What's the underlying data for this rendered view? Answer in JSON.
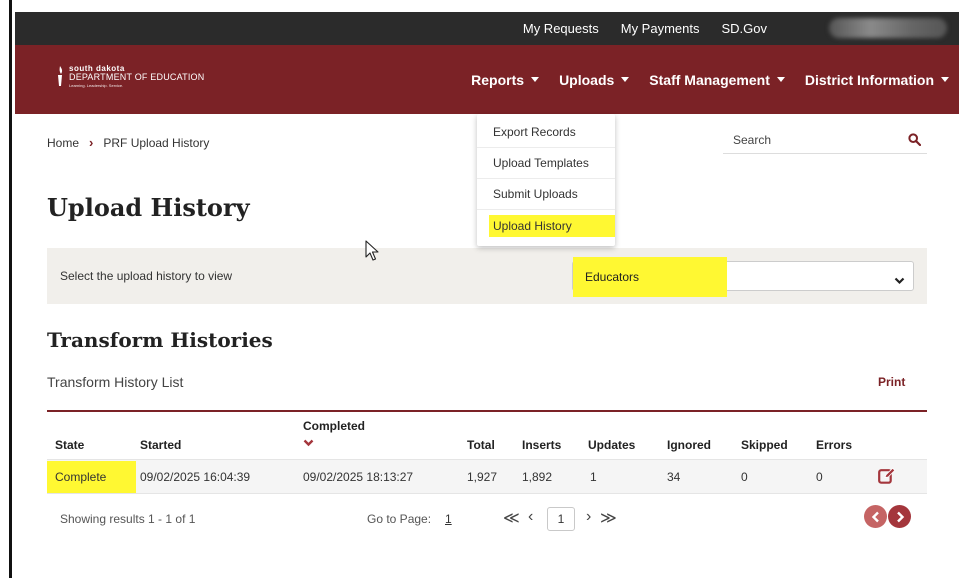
{
  "utility": {
    "links": [
      "My Requests",
      "My Payments",
      "SD.Gov"
    ]
  },
  "logo": {
    "line1": "south dakota",
    "line2": "DEPARTMENT OF EDUCATION",
    "line3": "Learning. Leadership. Service."
  },
  "nav": {
    "items": [
      "Reports",
      "Uploads",
      "Staff Management",
      "District Information"
    ]
  },
  "breadcrumb": {
    "home": "Home",
    "current": "PRF Upload History"
  },
  "search": {
    "placeholder": "Search"
  },
  "uploads_menu": {
    "items": [
      "Export Records",
      "Upload Templates",
      "Submit Uploads",
      "Upload History"
    ],
    "highlighted": "Upload History"
  },
  "page": {
    "title": "Upload History",
    "filter_label": "Select the upload history to view",
    "selected_history": "Educators"
  },
  "transform": {
    "section_title": "Transform Histories",
    "list_title": "Transform History List",
    "print_label": "Print",
    "columns": [
      "State",
      "Started",
      "Completed",
      "Total",
      "Inserts",
      "Updates",
      "Ignored",
      "Skipped",
      "Errors"
    ],
    "rows": [
      {
        "state": "Complete",
        "started": "09/02/2025 16:04:39",
        "completed": "09/02/2025 18:13:27",
        "total": "1,927",
        "inserts": "1,892",
        "updates": "1",
        "ignored": "34",
        "skipped": "0",
        "errors": "0"
      }
    ]
  },
  "pagination": {
    "results_text": "Showing results 1 - 1 of 1",
    "goto_label": "Go to Page:",
    "goto_value": "1",
    "current_page": "1",
    "first_symbol": "≪",
    "prev_symbol": "‹",
    "next_symbol": "›",
    "last_symbol": "≫"
  },
  "colors": {
    "brand": "#7b2226",
    "highlight": "#fff832",
    "utility_bar": "#2b2b2b"
  }
}
